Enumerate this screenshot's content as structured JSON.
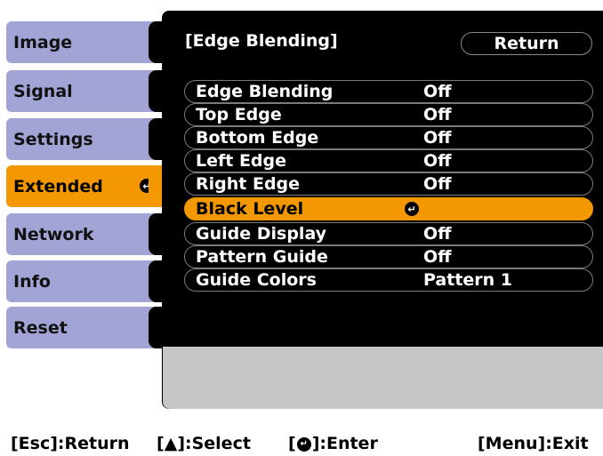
{
  "sidebar": {
    "items": [
      {
        "label": "Image"
      },
      {
        "label": "Signal"
      },
      {
        "label": "Settings"
      },
      {
        "label": "Extended",
        "active": true
      },
      {
        "label": "Network"
      },
      {
        "label": "Info"
      },
      {
        "label": "Reset"
      }
    ]
  },
  "panel": {
    "title": "[Edge Blending]",
    "return_label": "Return",
    "rows": [
      {
        "label": "Edge Blending",
        "value": "Off"
      },
      {
        "label": "Top Edge",
        "value": "Off"
      },
      {
        "label": "Bottom Edge",
        "value": "Off"
      },
      {
        "label": "Left Edge",
        "value": "Off"
      },
      {
        "label": "Right Edge",
        "value": "Off"
      },
      {
        "label": "Black Level",
        "value": "",
        "selected": true
      },
      {
        "label": "Guide Display",
        "value": "Off"
      },
      {
        "label": "Pattern Guide",
        "value": "Off"
      },
      {
        "label": "Guide Colors",
        "value": "Pattern 1"
      }
    ]
  },
  "bottom_bar": {
    "esc": "[Esc]:Return",
    "select_prefix": "[",
    "select_suffix": "]:Select",
    "enter_prefix": "[",
    "enter_suffix": "]:Enter",
    "menu": "[Menu]:Exit"
  },
  "colors": {
    "menu_bg": "#a3a4d6",
    "accent": "#f39800",
    "panel_bg": "#000000",
    "panel_grey": "#c6c6c6"
  },
  "icons": {
    "enter": "enter-icon",
    "updown": "up-down-arrows-icon"
  }
}
